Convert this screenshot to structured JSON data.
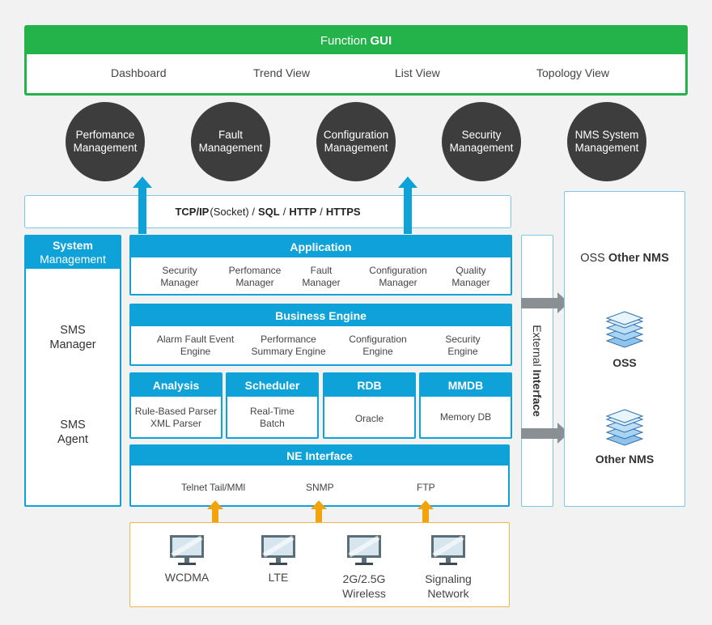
{
  "function_gui": {
    "title_light": "Function",
    "title_bold": "GUI",
    "items": [
      "Dashboard",
      "Trend View",
      "List View",
      "Topology View"
    ]
  },
  "management_circles": [
    {
      "line1": "Perfomance",
      "line2": "Management"
    },
    {
      "line1": "Fault",
      "line2": "Management"
    },
    {
      "line1": "Configuration",
      "line2": "Management"
    },
    {
      "line1": "Security",
      "line2": "Management"
    },
    {
      "line1": "NMS System",
      "line2": "Management"
    }
  ],
  "protocols": {
    "tcpip": "TCP/IP",
    "socket": "(Socket) /",
    "sql": "SQL",
    "sep1": "/",
    "http": "HTTP",
    "sep2": "/",
    "https": "HTTPS"
  },
  "system_management": {
    "title_line1": "System",
    "title_line2": "Management",
    "sms_manager_line1": "SMS",
    "sms_manager_line2": "Manager",
    "sms_agent_line1": "SMS",
    "sms_agent_line2": "Agent"
  },
  "application": {
    "title": "Application",
    "items": [
      {
        "line1": "Security",
        "line2": "Manager"
      },
      {
        "line1": "Perfomance",
        "line2": "Manager"
      },
      {
        "line1": "Fault",
        "line2": "Manager"
      },
      {
        "line1": "Configuration",
        "line2": "Manager"
      },
      {
        "line1": "Quality",
        "line2": "Manager"
      }
    ]
  },
  "business_engine": {
    "title": "Business Engine",
    "items": [
      {
        "line1": "Alarm Fault Event",
        "line2": "Engine"
      },
      {
        "line1": "Performance",
        "line2": "Summary Engine"
      },
      {
        "line1": "Configuration",
        "line2": "Engine"
      },
      {
        "line1": "Security",
        "line2": "Engine"
      }
    ]
  },
  "modules": {
    "analysis": {
      "title": "Analysis",
      "line1": "Rule-Based Parser",
      "line2": "XML Parser"
    },
    "scheduler": {
      "title": "Scheduler",
      "line1": "Real-Time",
      "line2": "Batch"
    },
    "rdb": {
      "title": "RDB",
      "line1": "Oracle"
    },
    "mmdb": {
      "title": "MMDB",
      "line1": "Memory DB"
    }
  },
  "ne_interface": {
    "title": "NE Interface",
    "items": [
      "Telnet Tail/MMl",
      "SNMP",
      "FTP"
    ]
  },
  "external_interface": {
    "light": "External",
    "bold": "Interface"
  },
  "oss_panel": {
    "title_light": "OSS",
    "title_bold": "Other NMS",
    "oss_label": "OSS",
    "other_nms_label": "Other NMS"
  },
  "network_elements": [
    {
      "line1": "WCDMA",
      "line2": ""
    },
    {
      "line1": "LTE",
      "line2": ""
    },
    {
      "line1": "2G/2.5G",
      "line2": "Wireless"
    },
    {
      "line1": "Signaling",
      "line2": "Network"
    }
  ],
  "colors": {
    "green": "#24b24b",
    "blue": "#0fa2d8",
    "dark_circle": "#3d3d3d",
    "orange": "#f2a30a",
    "gray_arrow": "#8a8f94"
  }
}
